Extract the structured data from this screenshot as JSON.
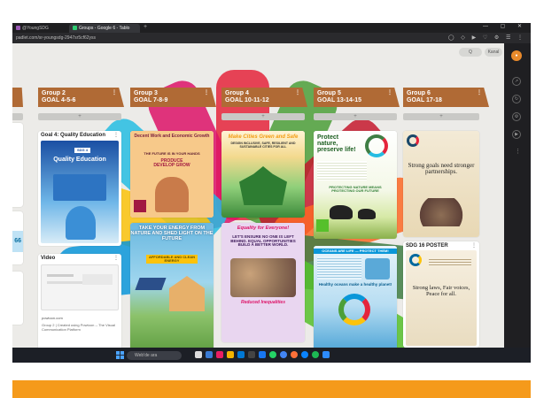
{
  "browser": {
    "tabs": [
      {
        "label": "@YoungSDG"
      },
      {
        "label": "Groups - Google 6 - Tablo"
      }
    ],
    "new_tab": "+",
    "url": "padlet.com/sr-youngsdg-2947sr5cf62yss",
    "window_controls": "— ▢ ✕"
  },
  "board": {
    "search_label": "Q",
    "kanal_label": "Kanal",
    "add_symbol": "+",
    "columns": [
      {
        "title": "Group 2",
        "subtitle": "GOAL 4-5-6"
      },
      {
        "title": "Group 3",
        "subtitle": "GOAL 7-8-9"
      },
      {
        "title": "Group 4",
        "subtitle": "GOAL 10-11-12"
      },
      {
        "title": "Group 5",
        "subtitle": "GOAL 13-14-15"
      },
      {
        "title": "Group 6",
        "subtitle": "GOAL 17-18"
      }
    ],
    "cards": {
      "g2_poster_title": "Goal 4: Quality Education",
      "g2_poster_tag": "SDG 4",
      "g2_poster_heading": "Quality Education",
      "g2_video_title": "Video",
      "g2_video_source": "powtoon.com",
      "g2_video_caption": "Group 2 | Created using Powtoon -- The Visual Communication Platform",
      "g3_p1_header": "Decent Work and Economic Growth",
      "g3_p1_line1": "THE FUTURE IS IN YOUR HANDS",
      "g3_p1_line2": "PRODUCE DEVELOP GROW",
      "g3_p2_line1": "TAKE YOUR ENERGY FROM NATURE AND SHED LIGHT ON THE FUTURE",
      "g3_p2_line2": "AFFORDABLE AND CLEAN ENERGY",
      "g4_p1_header": "Make Cities Green and Safe",
      "g4_p1_sub": "DESIGN INCLUSIVE, SAFE, RESILIENT AND SUSTAINABLE CITIES FOR ALL",
      "g4_p2_header": "Equality for Everyone!",
      "g4_p2_line": "LET'S ENSURE NO ONE IS LEFT BEHIND. EQUAL OPPORTUNITIES BUILD A BETTER WORLD.",
      "g4_p2_foot": "Reduced Inequalities",
      "g5_p1_line1": "Protect nature, preserve life!",
      "g5_p1_line2": "PROTECTING NATURE MEANS PROTECTING OUR FUTURE",
      "g5_p2_header": "OCEANS ARE LIFE — PROTECT THEM!",
      "g5_p2_line": "Healthy oceans make a healthy planet!",
      "g6_p1_line": "Strong goals need stronger partnerships.",
      "g6_p2_title": "SDG 16 POSTER",
      "g6_p2_line": "Strong laws, Fair voices, Peace for all."
    }
  },
  "taskbar": {
    "search_placeholder": "Web'de ara"
  },
  "colors": {
    "column_header": "#b06a35",
    "accent": "#e38a2b",
    "bottom_bar": "#f59a1b",
    "taskbar": "#1c1f26"
  }
}
